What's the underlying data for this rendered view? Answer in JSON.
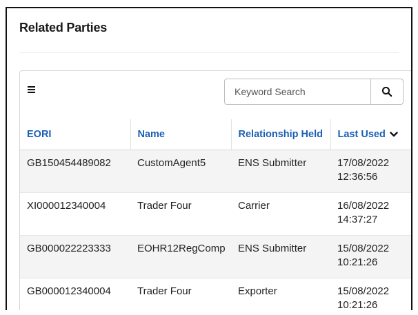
{
  "section": {
    "title": "Related Parties"
  },
  "toolbar": {
    "menu_icon": "hamburger-menu-icon",
    "search_placeholder": "Keyword Search",
    "search_icon": "search-icon"
  },
  "table": {
    "columns": [
      {
        "key": "eori",
        "label": "EORI"
      },
      {
        "key": "name",
        "label": "Name"
      },
      {
        "key": "relationship",
        "label": "Relationship Held"
      },
      {
        "key": "last_used",
        "label": "Last Used",
        "sort": "descending",
        "sort_icon": "chevron-down-icon"
      }
    ],
    "rows": [
      {
        "eori": "GB150454489082",
        "name": "CustomAgent5",
        "relationship": "ENS Submitter",
        "date": "17/08/2022",
        "time": "12:36:56"
      },
      {
        "eori": "XI000012340004",
        "name": "Trader Four",
        "relationship": "Carrier",
        "date": "16/08/2022",
        "time": "14:37:27"
      },
      {
        "eori": "GB000022223333",
        "name": "EOHR12RegComp",
        "relationship": "ENS Submitter",
        "date": "15/08/2022",
        "time": "10:21:26"
      },
      {
        "eori": "GB000012340004",
        "name": "Trader Four",
        "relationship": "Exporter",
        "date": "15/08/2022",
        "time": "10:21:26"
      }
    ]
  },
  "colors": {
    "header_link": "#1a5fb4",
    "row_stripe": "#f4f4f4",
    "border": "#d6d6d6"
  }
}
